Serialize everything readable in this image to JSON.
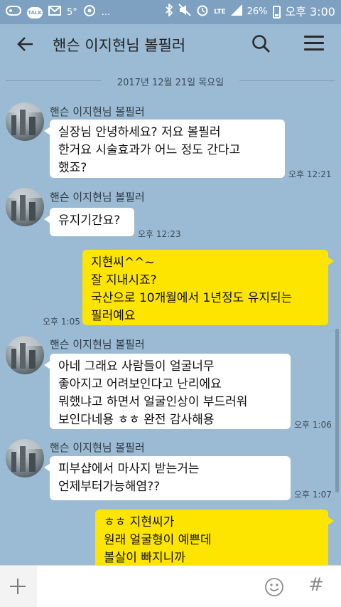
{
  "status_bar": {
    "temperature": "5°",
    "talk_badge": "TALK",
    "ellipsis": "...",
    "network": "LTE",
    "battery": "26%",
    "time": "오후 3:00"
  },
  "header": {
    "title": "핸슨 이지현님 볼필러"
  },
  "date_separator": "2017년 12월 21일 목요일",
  "messages": [
    {
      "sender": "핸슨 이지현님 볼필러",
      "text": "실장님 안녕하세요? 저요 볼필러\n한거요 시술효과가 어느 정도 간다고\n했죠?",
      "time": "오후 12:21"
    },
    {
      "sender": "핸슨 이지현님 볼필러",
      "text": "유지기간요?",
      "time": "오후 12:23"
    },
    {
      "text": "지현씨^^~\n잘 지내시죠?\n국산으로 10개월에서 1년정도 유지되는\n필러예요",
      "time": "오후 1:05"
    },
    {
      "sender": "핸슨 이지현님 볼필러",
      "text": "아네 그래요 사람들이 얼굴너무\n좋아지고 어려보인다고 난리에요\n뭐했냐고 하면서 얼굴인상이 부드러워\n보인다네용 ㅎㅎ 완전 감사해용",
      "time": "오후 1:06"
    },
    {
      "sender": "핸슨 이지현님 볼필러",
      "text": "피부샵에서 마사지 받는거는\n언제부터가능해염??",
      "time": "오후 1:07"
    },
    {
      "text": "ㅎㅎ 지현씨가\n원래 얼굴형이 예쁜데\n볼살이 빠지니까"
    }
  ],
  "input": {
    "value": "",
    "hash_label": "#"
  },
  "colors": {
    "background": "#9bbbd4",
    "incoming_bubble": "#ffffff",
    "outgoing_bubble": "#fee500"
  }
}
